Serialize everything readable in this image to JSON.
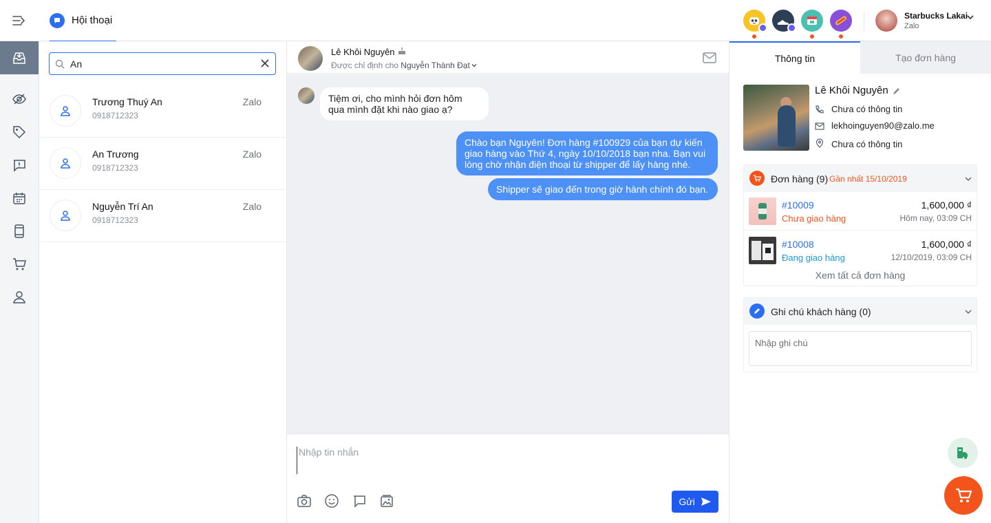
{
  "header": {
    "tab_label": "Hội thoại",
    "shop": {
      "name": "Starbucks Lakai",
      "platform": "Zalo"
    }
  },
  "channels": [
    {
      "icon": "robot-channel-icon",
      "color": "#f7c325",
      "has_messenger_badge": true,
      "has_dot": true
    },
    {
      "icon": "sneaker-channel-icon",
      "color": "#2d3e55",
      "has_messenger_badge": true,
      "has_dot": false
    },
    {
      "icon": "shop-channel-icon",
      "color": "#4bbfb0",
      "has_messenger_badge": false,
      "has_dot": true
    },
    {
      "icon": "hotdog-channel-icon",
      "color": "#8a4fd8",
      "has_messenger_badge": false,
      "has_dot": true
    }
  ],
  "nav": [
    {
      "icon": "inbox-icon",
      "active": true
    },
    {
      "icon": "eye-off-icon",
      "active": false
    },
    {
      "icon": "tag-icon",
      "active": false
    },
    {
      "icon": "chat-alert-icon",
      "active": false
    },
    {
      "icon": "calendar-icon",
      "active": false
    },
    {
      "icon": "mobile-icon",
      "active": false
    },
    {
      "icon": "cart-icon",
      "active": false
    },
    {
      "icon": "user-icon",
      "active": false
    }
  ],
  "search": {
    "value": "An",
    "placeholder": ""
  },
  "contacts": [
    {
      "name": "Trương Thuý An",
      "phone": "0918712323",
      "source": "Zalo"
    },
    {
      "name": "An Trương",
      "phone": "0918712323",
      "source": "Zalo"
    },
    {
      "name": "Nguyễn Trí An",
      "phone": "0918712323",
      "source": "Zalo"
    }
  ],
  "chat": {
    "customer_name": "Lê Khôi Nguyên",
    "assign_prefix": "Được chỉ định cho ",
    "assigned_to": "Nguyễn Thành Đạt",
    "messages": [
      {
        "direction": "in",
        "text": "Tiệm ơi, cho mình hỏi đơn hôm qua mình đặt khi nào giao ạ?"
      },
      {
        "direction": "out",
        "text": "Chào bạn Nguyên! Đơn hàng #100929 của bạn dự kiến giao hàng vào Thứ 4, ngày 10/10/2018 bạn nha. Bạn vui lòng chờ nhận điện thoại từ shipper để lấy hàng nhé."
      },
      {
        "direction": "out",
        "text": "Shipper sẽ giao đến trong giờ hành chính đó bạn."
      }
    ],
    "composer_placeholder": "Nhập tin nhắn",
    "send_label": "Gửi"
  },
  "right_panel": {
    "tabs": [
      "Thông tin",
      "Tạo đơn hàng"
    ],
    "profile": {
      "name": "Lê Khôi Nguyên",
      "phone": "Chưa có thông tin",
      "email": "lekhoinguyen90@zalo.me",
      "address": "Chưa có thông tin"
    },
    "orders": {
      "title": "Đơn hàng (9)",
      "latest_prefix": "Gần nhất ",
      "latest_date": "15/10/2019",
      "items": [
        {
          "id": "#10009",
          "status": "Chưa giao hàng",
          "status_color": "#f2541b",
          "price": "1,600,000 ₫",
          "time": "Hôm nay, 03:09 CH"
        },
        {
          "id": "#10008",
          "status": "Đang giao hàng",
          "status_color": "#1a9ad6",
          "price": "1,600,000 ₫",
          "time": "12/10/2019, 03:09 CH"
        }
      ],
      "see_all": "Xem tất cả đơn hàng"
    },
    "notes": {
      "title": "Ghi chú khách hàng (0)",
      "placeholder": "Nhập ghi chú"
    }
  },
  "colors": {
    "accent": "#2b6ff0",
    "outgoing_bubble": "#4d91f7",
    "orange": "#f2541b"
  }
}
